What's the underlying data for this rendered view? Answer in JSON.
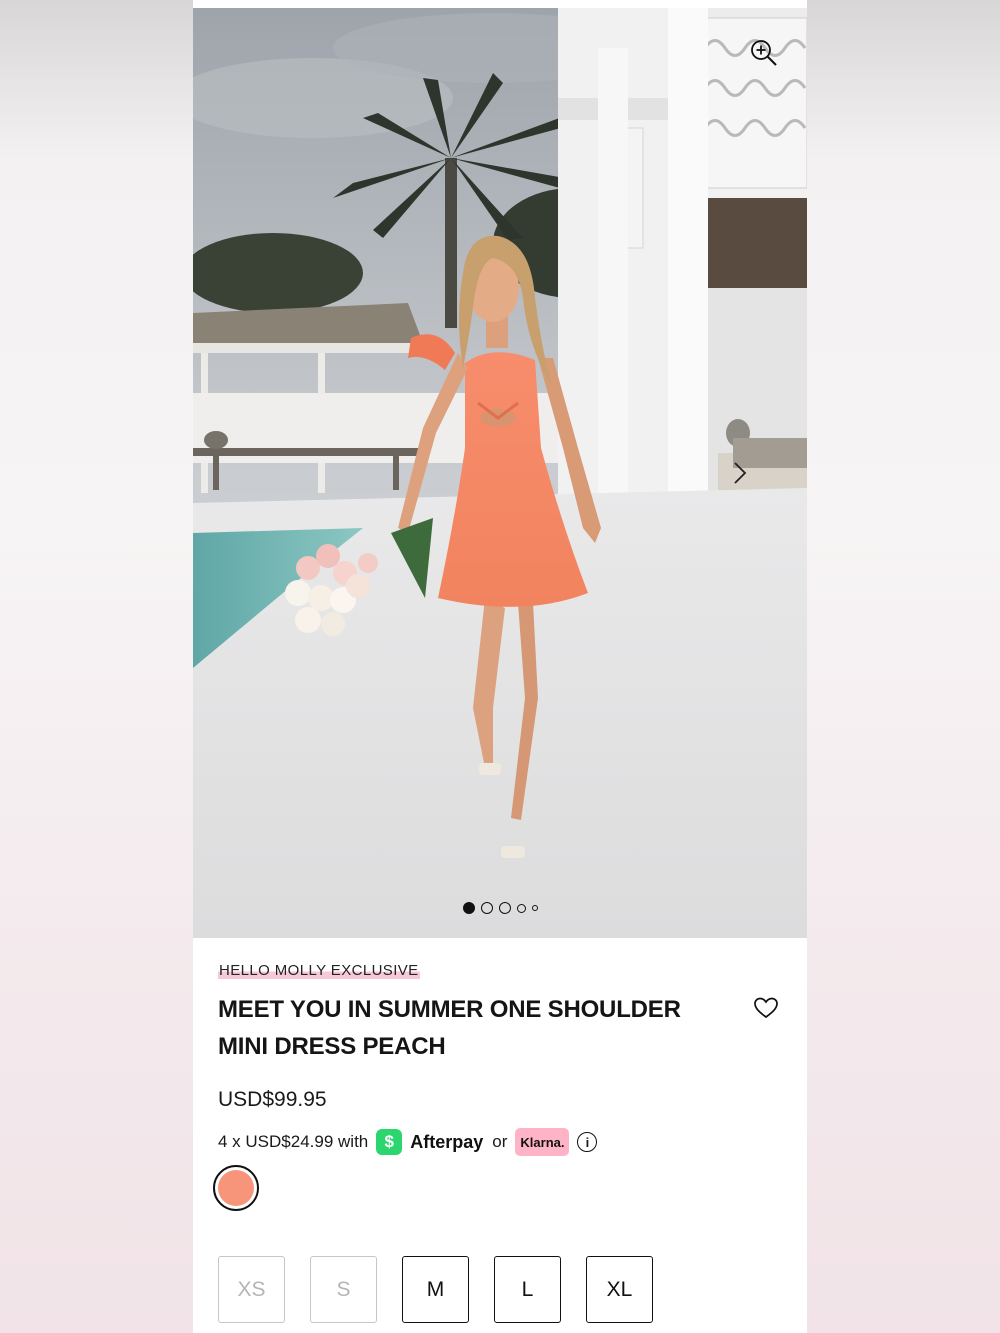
{
  "hero": {
    "image_alt": "Model wearing peach one shoulder mini dress holding roses by a pool",
    "carousel": {
      "total": 5,
      "active": 0
    }
  },
  "product": {
    "brand_tag": "HELLO MOLLY EXCLUSIVE",
    "title_line1": "MEET YOU IN SUMMER ONE SHOULDER",
    "title_line2": "MINI DRESS PEACH",
    "price": "USD$99.95",
    "installments_text": "4 x USD$24.99 with",
    "afterpay_symbol": "$",
    "afterpay_label": "Afterpay",
    "or_text": "or",
    "klarna_label": "Klarna.",
    "info_symbol": "i",
    "swatch_color": "#f6957a",
    "sizes": [
      {
        "label": "XS",
        "available": false
      },
      {
        "label": "S",
        "available": false
      },
      {
        "label": "M",
        "available": true
      },
      {
        "label": "L",
        "available": true
      },
      {
        "label": "XL",
        "available": true
      }
    ]
  },
  "colors": {
    "afterpay_green": "#2bd66e",
    "klarna_pink": "#ffb3c7",
    "brand_highlight": "#f7c9d8",
    "dress_peach": "#f6957a"
  }
}
